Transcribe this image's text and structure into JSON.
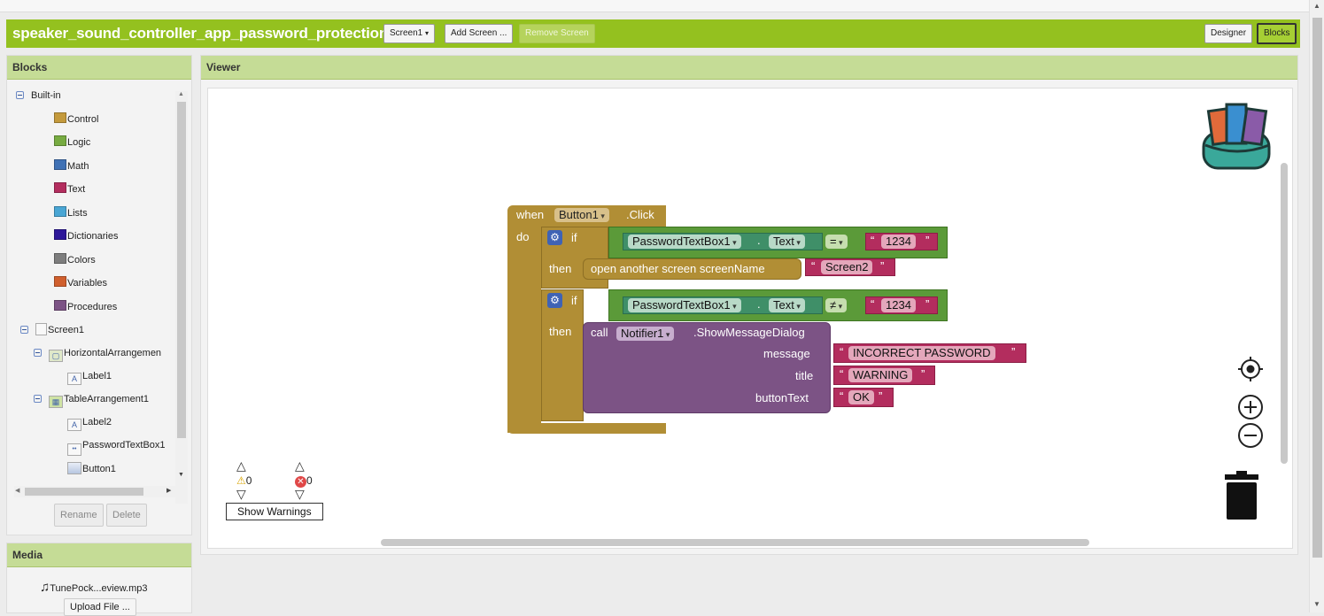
{
  "project_title": "speaker_sound_controller_app_password_protection",
  "toolbar": {
    "screen_select": "Screen1",
    "add_screen": "Add Screen ...",
    "remove_screen": "Remove Screen",
    "designer": "Designer",
    "blocks": "Blocks"
  },
  "blocks_panel": {
    "title": "Blocks",
    "builtin_label": "Built-in",
    "builtin": [
      {
        "label": "Control",
        "color": "#c49a3c"
      },
      {
        "label": "Logic",
        "color": "#77ab41"
      },
      {
        "label": "Math",
        "color": "#3f71b5"
      },
      {
        "label": "Text",
        "color": "#b32d5e"
      },
      {
        "label": "Lists",
        "color": "#49a6d4"
      },
      {
        "label": "Dictionaries",
        "color": "#2d1799"
      },
      {
        "label": "Colors",
        "color": "#7d7d7d"
      },
      {
        "label": "Variables",
        "color": "#d05f2d"
      },
      {
        "label": "Procedures",
        "color": "#7c5385"
      }
    ],
    "screen_label": "Screen1",
    "components": {
      "horizontal": "HorizontalArrangemen",
      "label1": "Label1",
      "table": "TableArrangement1",
      "label2": "Label2",
      "password": "PasswordTextBox1",
      "button": "Button1"
    },
    "rename": "Rename",
    "delete": "Delete"
  },
  "media_panel": {
    "title": "Media",
    "file": "TunePock...eview.mp3",
    "upload": "Upload File ..."
  },
  "viewer": {
    "title": "Viewer",
    "event": {
      "when": "when",
      "component": "Button1",
      "event": ".Click",
      "do": "do"
    },
    "if1": {
      "if": "if",
      "then": "then",
      "getter_component": "PasswordTextBox1",
      "dot": ".",
      "getter_prop": "Text",
      "op": "=",
      "text_value": "1234",
      "action": "open another screen  screenName",
      "screen_value": "Screen2"
    },
    "if2": {
      "if": "if",
      "then": "then",
      "getter_component": "PasswordTextBox1",
      "dot": ".",
      "getter_prop": "Text",
      "op": "≠",
      "text_value": "1234",
      "call": "call",
      "call_component": "Notifier1",
      "method": ".ShowMessageDialog",
      "arg_message": "message",
      "arg_title": "title",
      "arg_button": "buttonText",
      "message_value": "INCORRECT PASSWORD",
      "title_value": "WARNING",
      "button_value": "OK"
    },
    "warnings_count": "0",
    "errors_count": "0",
    "show_warnings": "Show Warnings"
  },
  "colors": {
    "toolbar_green": "#94c11f",
    "control_block": "#b18e35",
    "logic_block": "#5b9a39",
    "getter_block": "#3f8f68",
    "text_block": "#b32d5e",
    "component_block": "#7c5385"
  }
}
